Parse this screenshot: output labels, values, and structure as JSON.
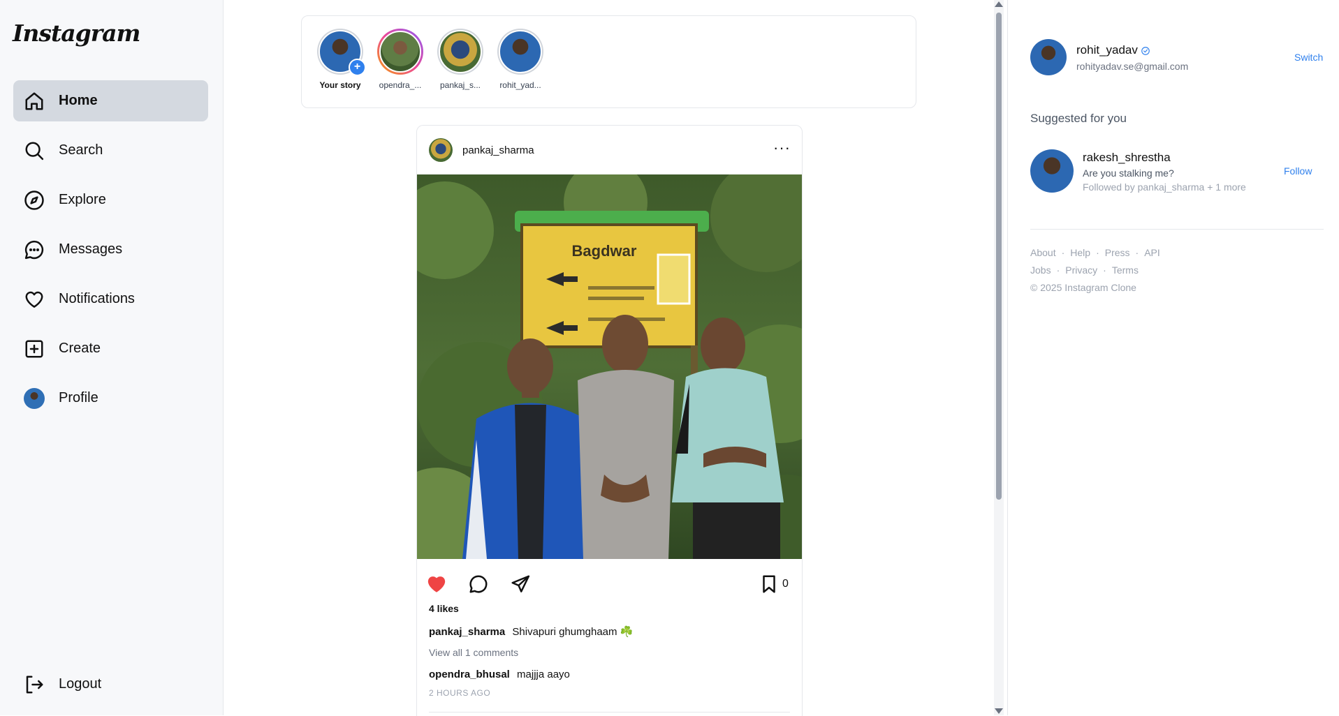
{
  "app": {
    "logo_text": "Instagram"
  },
  "sidebar": {
    "items": [
      {
        "label": "Home",
        "icon": "home-icon",
        "active": true
      },
      {
        "label": "Search",
        "icon": "search-icon"
      },
      {
        "label": "Explore",
        "icon": "compass-icon"
      },
      {
        "label": "Messages",
        "icon": "chat-bubble-icon"
      },
      {
        "label": "Notifications",
        "icon": "heart-icon"
      },
      {
        "label": "Create",
        "icon": "plus-square-icon"
      },
      {
        "label": "Profile",
        "icon": "avatar"
      }
    ],
    "logout_label": "Logout"
  },
  "stories": [
    {
      "name": "Your story",
      "own": true
    },
    {
      "name": "opendra_...",
      "active": true
    },
    {
      "name": "pankaj_s..."
    },
    {
      "name": "rohit_yad..."
    }
  ],
  "post": {
    "username": "pankaj_sharma",
    "more_icon": "···",
    "image_sign_text": "Bagdwar",
    "liked": true,
    "like_color": "#ef4444",
    "save_count": "0",
    "likes_text": "4 likes",
    "caption_user": "pankaj_sharma",
    "caption_text": "Shivapuri ghumghaam ☘️",
    "view_comments": "View all 1 comments",
    "comment_user": "opendra_bhusal",
    "comment_text": "majjja aayo",
    "timestamp": "2 HOURS AGO"
  },
  "right_panel": {
    "username": "rohit_yadav",
    "email": "rohityadav.se@gmail.com",
    "switch_label": "Switch",
    "suggested_title": "Suggested for you",
    "suggestion": {
      "username": "rakesh_shrestha",
      "bio": "Are you stalking me?",
      "followed_by": "Followed by pankaj_sharma + 1 more",
      "follow_label": "Follow"
    },
    "footer_links_row1": [
      "About",
      "Help",
      "Press",
      "API"
    ],
    "footer_links_row2": [
      "Jobs",
      "Privacy",
      "Terms"
    ],
    "copyright": "© 2025 Instagram Clone"
  },
  "colors": {
    "accent": "#2f80ed",
    "active_nav_bg": "#d4d9e0",
    "like": "#ef4444"
  }
}
